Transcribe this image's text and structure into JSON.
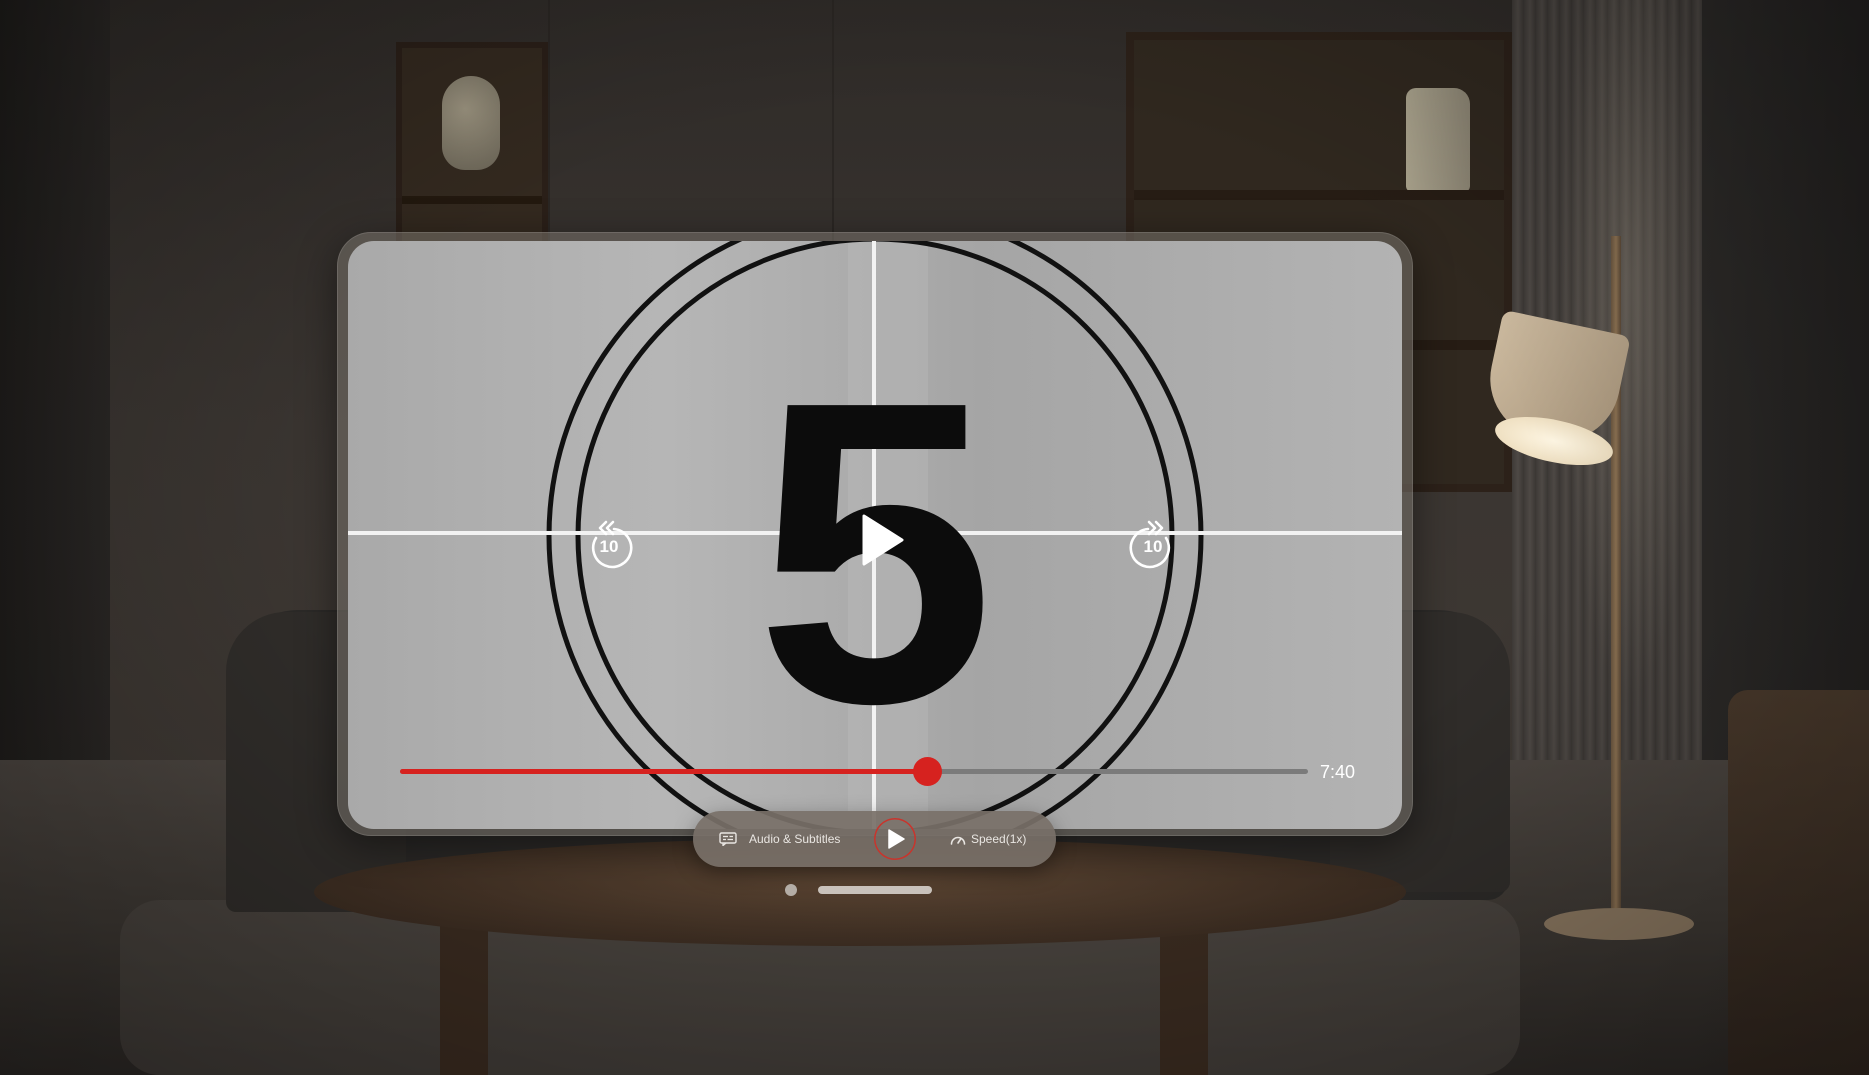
{
  "player": {
    "countdown_number": "5",
    "skip_back_seconds": "10",
    "skip_forward_seconds": "10",
    "duration": "7:40",
    "progress_fraction": 0.58
  },
  "controls": {
    "audio_subtitles_label": "Audio & Subtitles",
    "speed_label": "Speed(1x)"
  },
  "icons": {
    "skip_back": "rotate-back-icon",
    "skip_forward": "rotate-forward-icon",
    "play": "play-icon",
    "subtitles": "subtitles-icon",
    "speed": "speedometer-icon"
  },
  "colors": {
    "accent": "#d6221f"
  }
}
